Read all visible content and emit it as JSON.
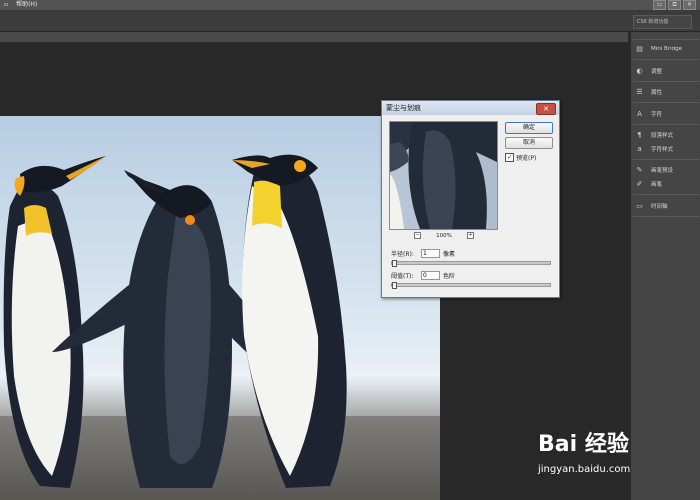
{
  "menubar": {
    "items": [
      "▫",
      "帮助(H)"
    ],
    "window_controls": [
      "▭",
      "⧉",
      "✕"
    ]
  },
  "options_bar": {
    "workspace": "CS6 新增功能"
  },
  "panels": {
    "items": [
      {
        "label": "Mini Bridge",
        "icon": "mini-bridge-icon",
        "glyph": "▤"
      },
      {
        "label": "调整",
        "icon": "adjustments-icon",
        "glyph": "◐"
      },
      {
        "label": "属性",
        "icon": "properties-icon",
        "glyph": "☰"
      },
      {
        "label": "字符",
        "icon": "character-icon",
        "glyph": "A"
      },
      {
        "label": "段落样式",
        "icon": "paragraph-styles-icon",
        "glyph": "¶"
      },
      {
        "label": "字符样式",
        "icon": "character-styles-icon",
        "glyph": "a"
      },
      {
        "label": "画笔预设",
        "icon": "brush-presets-icon",
        "glyph": "✎"
      },
      {
        "label": "画笔",
        "icon": "brush-icon",
        "glyph": "✐"
      },
      {
        "label": "时间轴",
        "icon": "timeline-icon",
        "glyph": "▭"
      }
    ]
  },
  "dialog": {
    "title": "蒙尘与划痕",
    "close": "✕",
    "ok": "确定",
    "cancel": "取消",
    "preview_label": "预览(P)",
    "preview_checked": "✓",
    "zoom_out": "−",
    "zoom": "100%",
    "zoom_in": "+",
    "radius_label": "半径(R):",
    "radius_value": "1",
    "radius_unit": "像素",
    "threshold_label": "阈值(T):",
    "threshold_value": "0",
    "threshold_unit": "色阶"
  },
  "watermark": {
    "logo": "Bai 经验",
    "sub": "jingyan.baidu.com"
  },
  "colors": {
    "canvas_bg": "#282828",
    "panel_bg": "#454545",
    "dialog_bg": "#efefef",
    "accent": "#3d7bbf",
    "close_red": "#c94f43"
  }
}
